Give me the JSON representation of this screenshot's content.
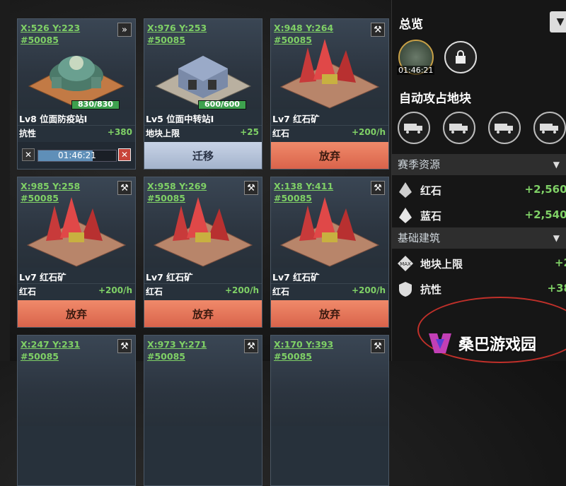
{
  "cards": [
    {
      "coord_xy": "X:526 Y:223",
      "coord_id": "#50085",
      "corner_icon": "fast-forward-icon",
      "name": "Lv8 位面防疫站I",
      "hp": "830/830",
      "hp_fraction": 1.0,
      "stat_label": "抗性",
      "stat_value": "+380",
      "timer": "01:46:21",
      "timer_fraction": 0.7,
      "kind": "timer"
    },
    {
      "coord_xy": "X:976 Y:253",
      "coord_id": "#50085",
      "name": "Lv5 位面中转站I",
      "hp": "600/600",
      "hp_fraction": 1.0,
      "stat_label": "地块上限",
      "stat_value": "+25",
      "button": "迁移",
      "kind": "move"
    },
    {
      "coord_xy": "X:948 Y:264",
      "coord_id": "#50085",
      "corner_icon": "tools-icon",
      "name": "Lv7 红石矿",
      "stat_label": "红石",
      "stat_value": "+200/h",
      "button": "放弃",
      "kind": "abandon"
    },
    {
      "coord_xy": "X:985 Y:258",
      "coord_id": "#50085",
      "corner_icon": "tools-icon",
      "name": "Lv7 红石矿",
      "stat_label": "红石",
      "stat_value": "+200/h",
      "button": "放弃",
      "kind": "abandon"
    },
    {
      "coord_xy": "X:958 Y:269",
      "coord_id": "#50085",
      "corner_icon": "tools-icon",
      "name": "Lv7 红石矿",
      "stat_label": "红石",
      "stat_value": "+200/h",
      "button": "放弃",
      "kind": "abandon"
    },
    {
      "coord_xy": "X:138 Y:411",
      "coord_id": "#50085",
      "corner_icon": "tools-icon",
      "name": "Lv7 红石矿",
      "stat_label": "红石",
      "stat_value": "+200/h",
      "button": "放弃",
      "kind": "abandon"
    },
    {
      "coord_xy": "X:247 Y:231",
      "coord_id": "#50085",
      "corner_icon": "tools-icon"
    },
    {
      "coord_xy": "X:973 Y:271",
      "coord_id": "#50085",
      "corner_icon": "tools-icon"
    },
    {
      "coord_xy": "X:170 Y:393",
      "coord_id": "#50085",
      "corner_icon": "tools-icon"
    }
  ],
  "panel": {
    "title": "总览",
    "hero_timer": "01:46:21",
    "auto_attack_title": "自动攻占地块",
    "season_header": "赛季资源",
    "resources": [
      {
        "label": "红石",
        "value": "+2,560/",
        "icon": "red-crystal-icon"
      },
      {
        "label": "蓝石",
        "value": "+2,540/",
        "icon": "blue-crystal-icon"
      }
    ],
    "basic_header": "基础建筑",
    "buildings": [
      {
        "label": "地块上限",
        "value": "+2",
        "icon": "max-icon"
      },
      {
        "label": "抗性",
        "value": "+38",
        "icon": "shield-icon"
      }
    ]
  },
  "watermark": "桑巴游戏园",
  "colors": {
    "green": "#7fd066",
    "abandon": "#e0704f",
    "move": "#b4c2d8",
    "oval": "#c0302a"
  }
}
